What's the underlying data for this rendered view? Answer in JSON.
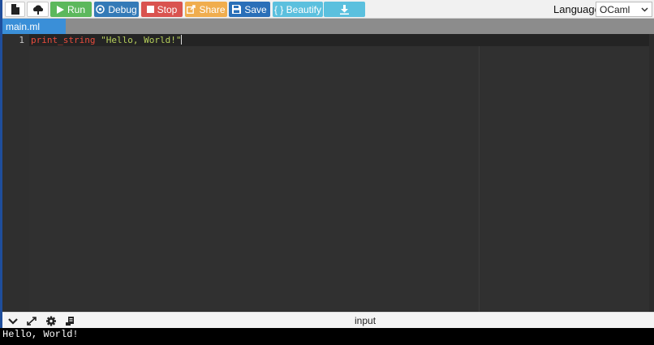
{
  "toolbar": {
    "run_label": "Run",
    "debug_label": "Debug",
    "stop_label": "Stop",
    "share_label": "Share",
    "save_label": "Save",
    "beautify_label": "{ } Beautify",
    "language_label": "Language",
    "language_value": "OCaml"
  },
  "tabs": [
    {
      "label": "main.ml"
    }
  ],
  "editor": {
    "line_number": "1",
    "code_function": "print_string",
    "code_string": "\"Hello, World!\""
  },
  "console": {
    "input_label": "input",
    "output": "Hello, World!"
  },
  "colors": {
    "run": "#5cb85c",
    "debug": "#337ab7",
    "stop": "#d9534f",
    "share": "#f0ad4e",
    "save": "#2a6fb8",
    "beautify": "#5bc0de",
    "download": "#5bc0de",
    "tab_active": "#3a8fd8",
    "editor_bg": "#303030"
  },
  "icons": {
    "new_file": "file-icon",
    "upload": "cloud-upload-icon",
    "run": "play-icon",
    "debug": "debug-icon",
    "stop": "stop-icon",
    "share": "share-icon",
    "save": "floppy-icon",
    "download": "download-icon",
    "collapse": "chevron-down-icon",
    "expand": "expand-icon",
    "settings": "gear-icon",
    "console_tool": "terminal-icon"
  }
}
